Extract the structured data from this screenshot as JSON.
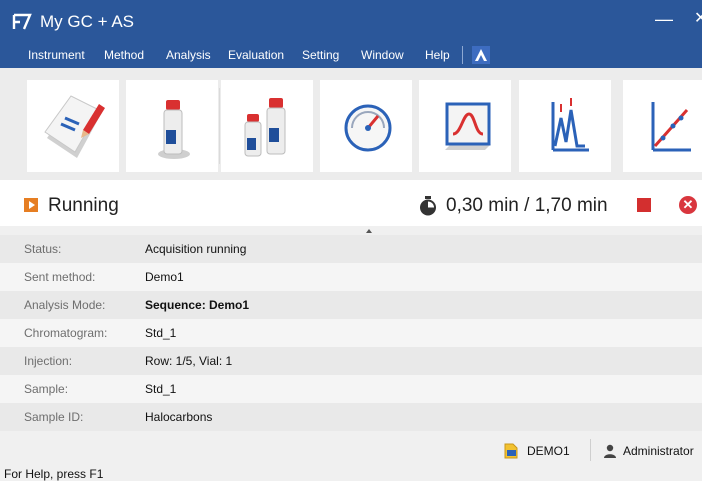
{
  "window": {
    "title": "My GC + AS",
    "minimize_glyph": "—",
    "close_glyph": "✕"
  },
  "menu": [
    "Instrument",
    "Method",
    "Analysis",
    "Evaluation",
    "Setting",
    "Window",
    "Help"
  ],
  "toolbar": {
    "buttons": [
      {
        "icon": "edit-method-icon"
      },
      {
        "icon": "single-sample-icon"
      },
      {
        "icon": "sequence-samples-icon"
      },
      {
        "icon": "instrument-status-gauge-icon"
      },
      {
        "icon": "chromatogram-monitor-icon"
      },
      {
        "icon": "evaluation-peaks-icon"
      },
      {
        "icon": "calibration-icon"
      }
    ]
  },
  "run": {
    "status": "Running",
    "elapsed": "0,30 min / 1,70 min"
  },
  "details": [
    {
      "label": "Status:",
      "value": "Acquisition running",
      "bold": false
    },
    {
      "label": "Sent method:",
      "value": "Demo1",
      "bold": false
    },
    {
      "label": "Analysis Mode:",
      "value": "Sequence: Demo1",
      "bold": true
    },
    {
      "label": "Chromatogram:",
      "value": "Std_1",
      "bold": false
    },
    {
      "label": "Injection:",
      "value": "Row: 1/5, Vial: 1",
      "bold": false
    },
    {
      "label": "Sample:",
      "value": "Std_1",
      "bold": false
    },
    {
      "label": "Sample ID:",
      "value": "Halocarbons",
      "bold": false
    }
  ],
  "info": {
    "method": "DEMO1",
    "user": "Administrator"
  },
  "statusbar": {
    "help": "For Help, press F1"
  },
  "colors": {
    "accent": "#2b579a",
    "running": "#e67e22",
    "stop": "#d32f2f"
  }
}
